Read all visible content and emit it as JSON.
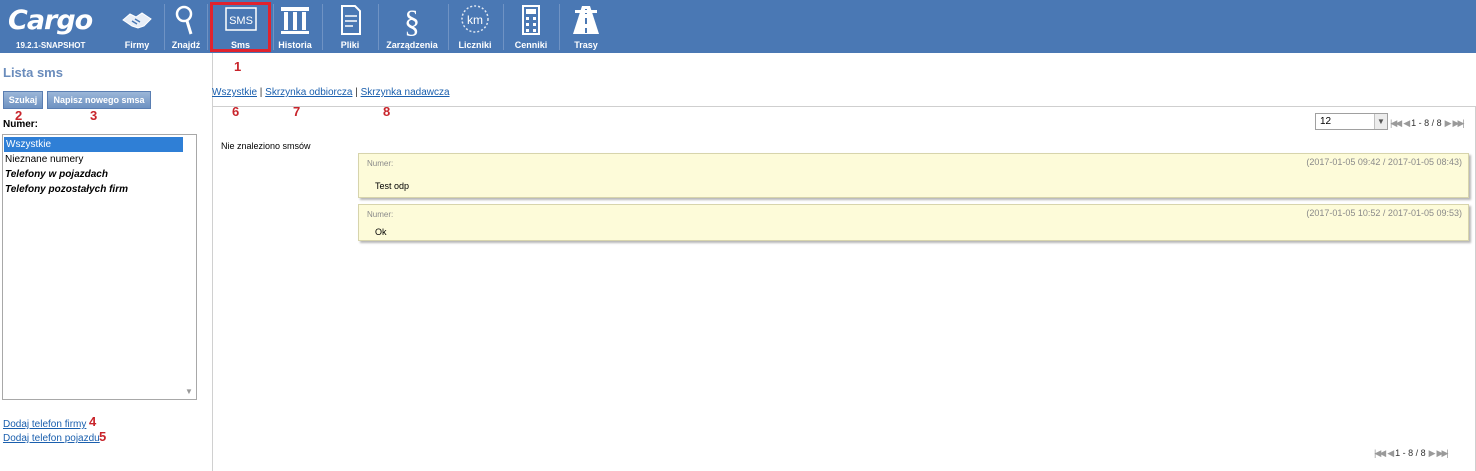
{
  "app": {
    "logo": "Cargo",
    "version": "19.2.1-SNAPSHOT"
  },
  "nav": [
    {
      "label": "Firmy",
      "icon": "handshake-icon"
    },
    {
      "label": "Znajdź",
      "icon": "magnifier-icon"
    },
    {
      "label": "Sms",
      "icon": "sms-icon",
      "icon_text": "SMS"
    },
    {
      "label": "Historia",
      "icon": "columns-icon"
    },
    {
      "label": "Pliki",
      "icon": "document-icon"
    },
    {
      "label": "Zarządzenia",
      "icon": "paragraph-icon",
      "icon_text": "§"
    },
    {
      "label": "Liczniki",
      "icon": "odometer-icon",
      "icon_text": "km"
    },
    {
      "label": "Cenniki",
      "icon": "calculator-icon"
    },
    {
      "label": "Trasy",
      "icon": "road-icon"
    }
  ],
  "annotations": [
    "1",
    "2",
    "3",
    "4",
    "5",
    "6",
    "7",
    "8"
  ],
  "sidebar": {
    "title": "Lista sms",
    "search_button": "Szukaj",
    "new_sms_button": "Napisz nowego smsa",
    "number_label": "Numer:",
    "list_items": [
      "Wszystkie",
      "Nieznane numery",
      "Telefony w pojazdach",
      "Telefony pozostałych firm"
    ],
    "add_company_phone": "Dodaj telefon firmy",
    "add_vehicle_phone": "Dodaj telefon pojazdu"
  },
  "filters": {
    "all": "Wszystkie",
    "separator": "|",
    "inbox": "Skrzynka odbiorcza",
    "outbox": "Skrzynka nadawcza"
  },
  "page_size": "12",
  "pager_text": "1 - 8 / 8",
  "empty_message": "Nie znaleziono smsów",
  "messages": [
    {
      "number_label": "Numer:",
      "dates": "(2017-01-05 09:42 / 2017-01-05 08:43)",
      "text": "Test odp"
    },
    {
      "number_label": "Numer:",
      "dates": "(2017-01-05 10:52 / 2017-01-05 09:53)",
      "text": "Ok"
    }
  ],
  "colors": {
    "topbar": "#4a78b4",
    "highlight": "#e0232e",
    "annotation": "#c8242b",
    "selected": "#2f7fd6",
    "message_bg": "#fdfbd9"
  }
}
